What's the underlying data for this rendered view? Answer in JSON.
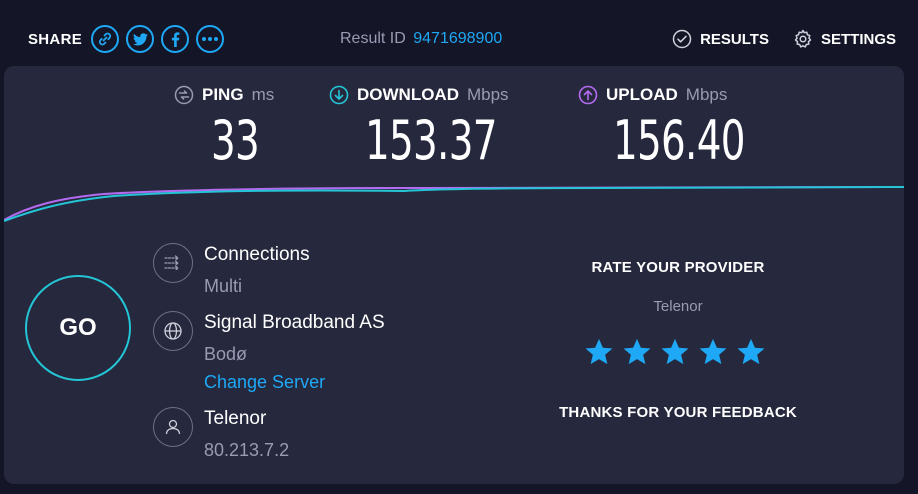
{
  "topbar": {
    "share_label": "SHARE",
    "share_icons": [
      "link-icon",
      "twitter-icon",
      "facebook-icon",
      "more-icon"
    ],
    "result_id_label": "Result ID",
    "result_id_value": "9471698900",
    "results_label": "RESULTS",
    "settings_label": "SETTINGS"
  },
  "metrics": {
    "ping": {
      "label": "PING",
      "unit": "ms",
      "value": "33"
    },
    "download": {
      "label": "DOWNLOAD",
      "unit": "Mbps",
      "value": "153.37"
    },
    "upload": {
      "label": "UPLOAD",
      "unit": "Mbps",
      "value": "156.40"
    }
  },
  "go_label": "GO",
  "connection": {
    "title": "Connections",
    "value": "Multi"
  },
  "server": {
    "title": "Signal Broadband AS",
    "location": "Bodø",
    "change_label": "Change Server"
  },
  "provider": {
    "title": "Telenor",
    "ip": "80.213.7.2"
  },
  "rating": {
    "title": "RATE YOUR PROVIDER",
    "provider": "Telenor",
    "stars": 5,
    "thanks": "THANKS FOR YOUR FEEDBACK"
  },
  "colors": {
    "background": "#141526",
    "panel": "#26283d",
    "accent_blue": "#1ea8f5",
    "download_cyan": "#23c5d6",
    "upload_purple": "#b46bf0",
    "star": "#1ea8f5"
  }
}
